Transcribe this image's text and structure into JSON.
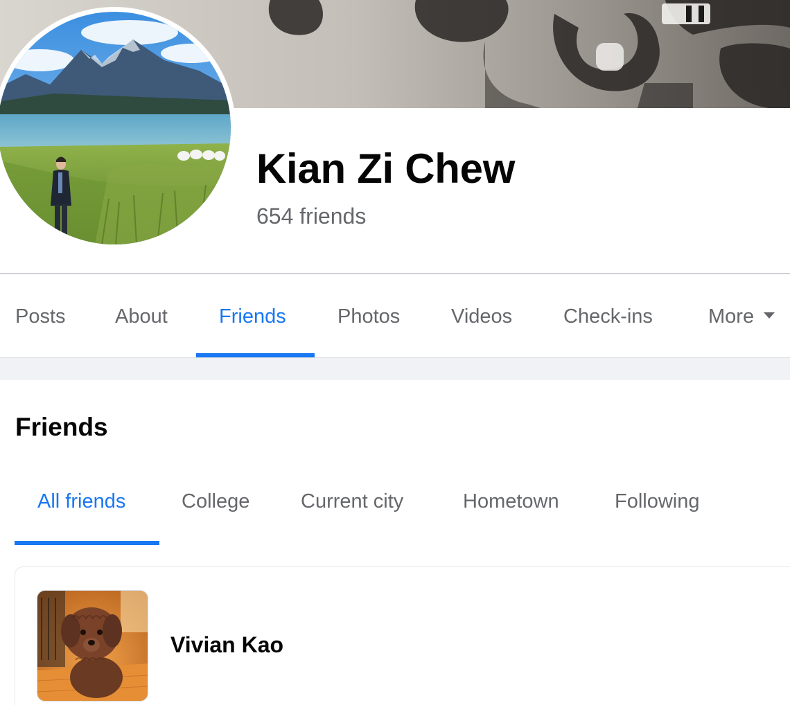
{
  "profile": {
    "name": "Kian Zi Chew",
    "friend_count": "654 friends"
  },
  "profile_tabs": [
    {
      "label": "Posts"
    },
    {
      "label": "About"
    },
    {
      "label": "Friends",
      "active": true
    },
    {
      "label": "Photos"
    },
    {
      "label": "Videos"
    },
    {
      "label": "Check-ins"
    },
    {
      "label": "More"
    }
  ],
  "friends_section": {
    "title": "Friends",
    "filter_tabs": [
      {
        "label": "All friends",
        "active": true
      },
      {
        "label": "College"
      },
      {
        "label": "Current city"
      },
      {
        "label": "Hometown"
      },
      {
        "label": "Following"
      }
    ],
    "friends": [
      {
        "name": "Vivian Kao"
      }
    ]
  },
  "colors": {
    "accent": "#1877f2",
    "secondary_text": "#65676b",
    "primary_text": "#050505",
    "divider": "#ced0d4",
    "band": "#f0f2f5"
  },
  "icons": {
    "more_caret": "caret-down-icon"
  }
}
